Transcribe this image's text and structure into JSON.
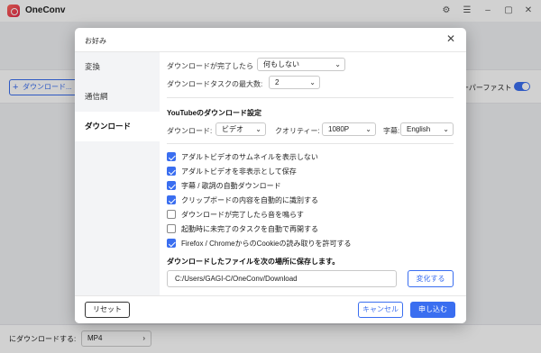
{
  "app": {
    "title": "OneConv",
    "add_button_label": "ダウンロード...",
    "superfast_label": "ーパーファスト",
    "download_to_label": "にダウンロードする:",
    "format_value": "MP4"
  },
  "dialog": {
    "title": "お好み",
    "sidebar": [
      {
        "label": "変換"
      },
      {
        "label": "通信網"
      },
      {
        "label": "ダウンロード"
      }
    ],
    "after_complete_label": "ダウンロードが完了したら",
    "after_complete_value": "何もしない",
    "max_tasks_label": "ダウンロードタスクの最大数:",
    "max_tasks_value": "2",
    "youtube_section_title": "YouTubeのダウンロード設定",
    "download_type_label": "ダウンロード:",
    "download_type_value": "ビデオ",
    "quality_label": "クオリティー:",
    "quality_value": "1080P",
    "subtitle_label": "字幕:",
    "subtitle_value": "English",
    "options": [
      {
        "label": "アダルトビデオのサムネイルを表示しない",
        "checked": true
      },
      {
        "label": "アダルトビデオを非表示として保存",
        "checked": true
      },
      {
        "label": "字幕 / 歌詞の自動ダウンロード",
        "checked": true
      },
      {
        "label": "クリップボードの内容を自動的に識別する",
        "checked": true
      },
      {
        "label": "ダウンロードが完了したら音を鳴らす",
        "checked": false
      },
      {
        "label": "起動時に未完了のタスクを自動で再開する",
        "checked": false
      },
      {
        "label": "Firefox / ChromeからのCookieの読み取りを許可する",
        "checked": true
      }
    ],
    "save_location_title": "ダウンロードしたファイルを次の場所に保存します。",
    "save_path": "C:/Users/GAGI-C/OneConv/Download",
    "change_button": "変化する",
    "reset_button": "リセット",
    "cancel_button": "キャンセル",
    "apply_button": "申し込む"
  },
  "colors": {
    "accent": "#3a6ef0",
    "overlay": "rgba(0,0,0,0.18)"
  }
}
